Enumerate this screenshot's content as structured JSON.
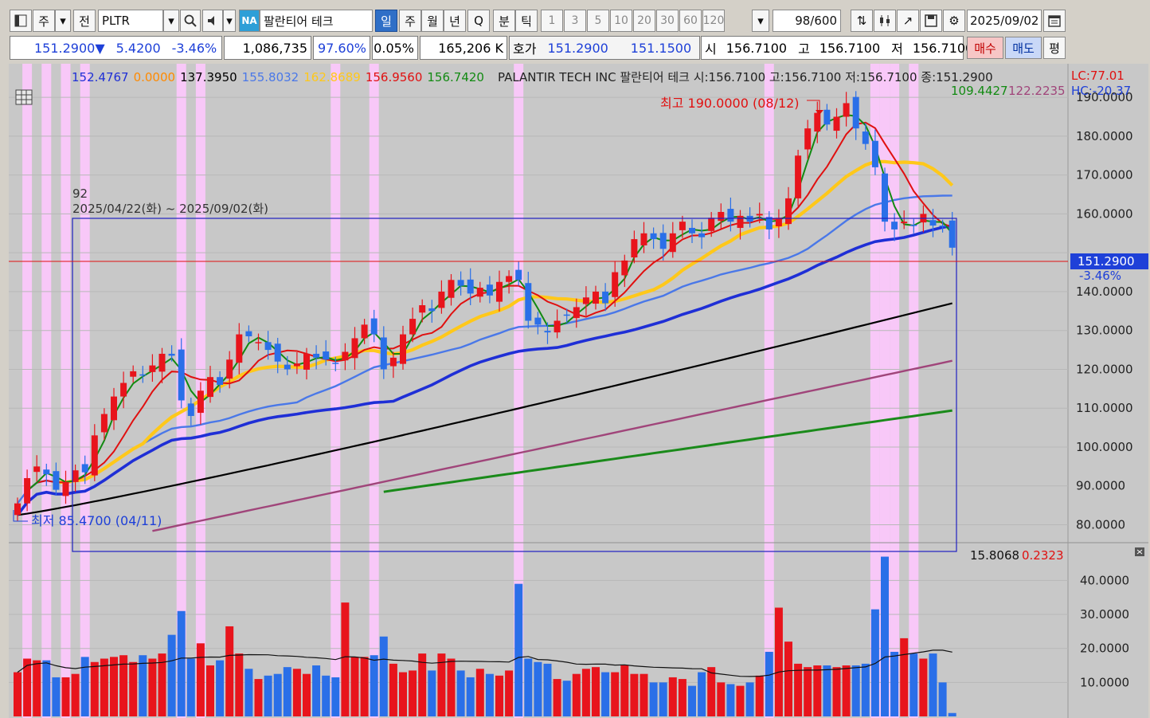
{
  "toolbar": {
    "period_unit": "주",
    "prev_label": "전",
    "symbol": "PLTR",
    "market_badge": "NA",
    "stock_name": "팔란티어 테크",
    "period_tabs": [
      "일",
      "주",
      "월",
      "년",
      "Q",
      "분",
      "틱"
    ],
    "active_period": "일",
    "interval_buttons": [
      "1",
      "3",
      "5",
      "10",
      "20",
      "30",
      "60",
      "120"
    ],
    "count_display": "98/600",
    "date": "2025/09/02"
  },
  "quote": {
    "price": "151.2900",
    "change_arrow": "▼",
    "change": "5.4200",
    "change_pct": "-3.46%",
    "volume": "1,086,735",
    "turnover_pct": "97.60%",
    "ratio_pct": "0.05%",
    "amount": "165,206 K",
    "bid_label": "호가",
    "bid": "151.2900",
    "ask": "151.1500",
    "open_label": "시",
    "open": "156.7100",
    "high_label": "고",
    "high": "156.7100",
    "low_label": "저",
    "low": "156.7100",
    "buy_label": "매수",
    "sell_label": "매도",
    "even_label": "평"
  },
  "chart_header": {
    "ma_values": [
      {
        "text": "152.4767",
        "color": "#1f2fd6"
      },
      {
        "text": "0.0000",
        "color": "#ff8a00"
      },
      {
        "text": "137.3950",
        "color": "#000000"
      },
      {
        "text": "155.8032",
        "color": "#4a78e8"
      },
      {
        "text": "162.8689",
        "color": "#ffc81a"
      },
      {
        "text": "156.9560",
        "color": "#e01010"
      },
      {
        "text": "156.7420",
        "color": "#128a12"
      }
    ],
    "title_line": "PALANTIR TECH INC  팔란티어 테크 시:156.7100 고:156.7100 저:156.7100 종:151.2900",
    "lc": "LC:77.01",
    "hc": "HC:-20.37",
    "sub_a": "109.4427",
    "sub_b": "122.2235",
    "high_marker": "최고 190.0000 (08/12)",
    "low_marker": "최저 85.4700 (04/11)",
    "range_count": "92",
    "range_text": "2025/04/22(화) ~ 2025/09/02(화)",
    "current_price_tag": "151.2900",
    "current_pct_tag": "-3.46%",
    "volume_readout_a": "15.8068",
    "volume_readout_b": "0.2323"
  },
  "colors": {
    "up": "#e8141c",
    "down": "#2a6fe8",
    "ma5": "#128a12",
    "ma20": "#e01010",
    "ma60": "#ffc81a",
    "ma120": "#4a78e8",
    "ma_thick": "#1f2fd6",
    "ma_black": "#000000",
    "ma_purple": "#a0457a",
    "ma_green": "#1a8a1a",
    "highlight": "#f8c8f8",
    "bg": "#c8c8c8"
  },
  "chart_data": {
    "type": "candlestick",
    "y_ticks": [
      "190.0000",
      "180.0000",
      "170.0000",
      "160.0000",
      "150.0000",
      "140.0000",
      "130.0000",
      "120.0000",
      "110.0000",
      "100.0000",
      "90.0000",
      "80.0000"
    ],
    "ylim": [
      76,
      197
    ],
    "volume_ticks": [
      "40.0000",
      "30.0000",
      "20.0000",
      "10.0000"
    ],
    "volume_ylim": [
      0,
      49
    ],
    "close": [
      85.5,
      92.0,
      95.0,
      93.0,
      89.0,
      91.0,
      94.0,
      93.5,
      103.0,
      108.5,
      113.0,
      116.5,
      119.5,
      118.5,
      121.0,
      124.0,
      123.5,
      112.0,
      108.0,
      114.5,
      118.0,
      116.0,
      122.5,
      129.0,
      128.5,
      127.0,
      125.0,
      122.0,
      120.0,
      121.5,
      124.0,
      123.0,
      122.5,
      121.5,
      124.5,
      128.0,
      131.5,
      129.0,
      120.0,
      123.0,
      129.0,
      133.0,
      136.5,
      135.0,
      140.0,
      143.0,
      141.5,
      139.5,
      141.0,
      139.0,
      142.5,
      144.0,
      143.0,
      132.5,
      131.5,
      129.5,
      132.5,
      134.0,
      136.0,
      138.5,
      140.0,
      137.0,
      145.0,
      148.0,
      153.5,
      155.0,
      153.5,
      151.0,
      155.0,
      158.0,
      155.0,
      154.0,
      159.0,
      160.5,
      158.0,
      159.5,
      158.0,
      160.0,
      156.0,
      159.0,
      164.0,
      175.0,
      182.0,
      186.0,
      183.0,
      185.0,
      188.5,
      182.0,
      178.0,
      172.0,
      158.0,
      156.0,
      158.0,
      157.0,
      160.0,
      157.0,
      156.7,
      151.3
    ],
    "volume": [
      13.0,
      17.0,
      16.5,
      16.5,
      11.5,
      11.5,
      12.5,
      17.5,
      16.0,
      17.0,
      17.5,
      18.0,
      16.0,
      18.0,
      17.0,
      18.5,
      24.0,
      31.0,
      17.0,
      21.5,
      15.0,
      16.5,
      26.5,
      18.5,
      14.0,
      11.0,
      12.0,
      12.5,
      14.5,
      14.0,
      12.5,
      15.0,
      12.0,
      11.5,
      33.5,
      17.5,
      17.5,
      18.0,
      23.5,
      15.5,
      13.0,
      13.5,
      18.5,
      13.5,
      18.5,
      17.0,
      13.5,
      11.5,
      14.0,
      12.5,
      12.0,
      13.5,
      39.0,
      17.0,
      16.0,
      15.5,
      11.0,
      10.5,
      12.5,
      14.0,
      14.5,
      13.0,
      13.0,
      15.0,
      12.5,
      12.5,
      10.0,
      10.0,
      11.5,
      11.0,
      9.0,
      13.0,
      14.5,
      10.0,
      9.5,
      9.0,
      10.0,
      12.0,
      19.0,
      32.0,
      22.0,
      15.5,
      14.5,
      15.0,
      15.0,
      14.5,
      15.0,
      15.0,
      15.5,
      31.5,
      47.0,
      19.0,
      23.0,
      18.5,
      17.0,
      18.5,
      10.0,
      1.0
    ]
  }
}
